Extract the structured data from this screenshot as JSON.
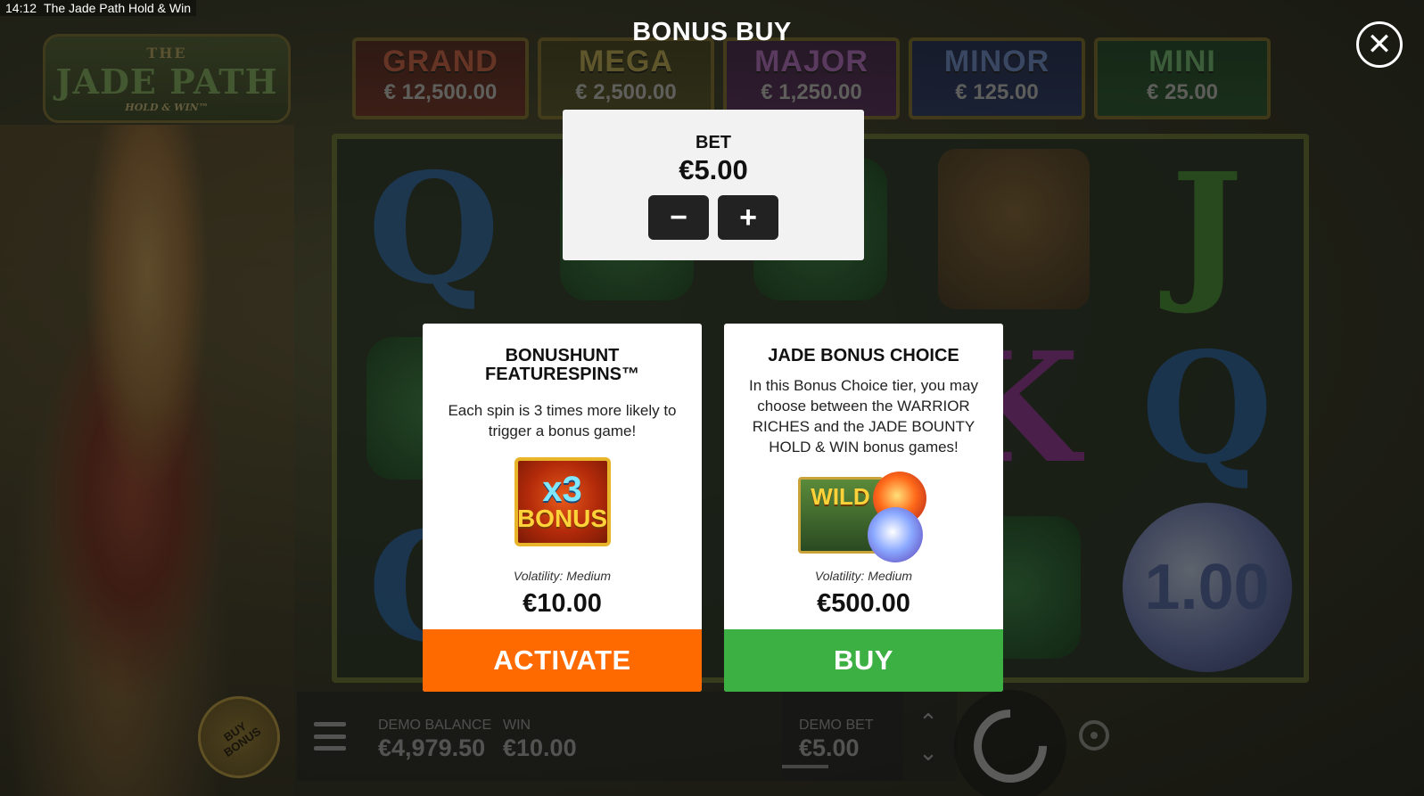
{
  "window": {
    "time": "14:12",
    "title": "The Jade Path Hold & Win"
  },
  "logo": {
    "the": "THE",
    "main": "JADE PATH",
    "sub": "HOLD & WIN™"
  },
  "jackpots": [
    {
      "name": "GRAND",
      "value": "€ 12,500.00"
    },
    {
      "name": "MEGA",
      "value": "€ 2,500.00"
    },
    {
      "name": "MAJOR",
      "value": "€ 1,250.00"
    },
    {
      "name": "MINOR",
      "value": "€ 125.00"
    },
    {
      "name": "MINI",
      "value": "€ 25.00"
    }
  ],
  "reels": {
    "symbols": [
      "Q",
      "mask",
      "mask",
      "warrior",
      "J",
      "mask",
      "mask",
      "mask",
      "K",
      "Q",
      "Q",
      "mask",
      "mask",
      "mask",
      "orb"
    ],
    "orb_value": "1.00"
  },
  "modal": {
    "title": "BONUS BUY",
    "close_icon": "close-icon",
    "bet": {
      "label": "BET",
      "value": "€5.00",
      "minus": "−",
      "plus": "+"
    },
    "cards": [
      {
        "title": "BONUSHUNT FEATURESPINS™",
        "description": "Each spin is 3 times more likely to trigger a bonus game!",
        "art": {
          "multiplier": "x3",
          "word": "BONUS"
        },
        "volatility": "Volatility: Medium",
        "price": "€10.00",
        "cta": "ACTIVATE"
      },
      {
        "title": "JADE BONUS CHOICE",
        "description": "In this Bonus Choice tier, you may choose between the WARRIOR RICHES and the JADE BOUNTY HOLD & WIN bonus games!",
        "art": {
          "word": "WILD"
        },
        "volatility": "Volatility: Medium",
        "price": "€500.00",
        "cta": "BUY"
      }
    ]
  },
  "bottom_bar": {
    "buy_bonus": "BUY BONUS",
    "demo_balance_label": "DEMO BALANCE",
    "demo_balance_value": "€4,979.50",
    "win_label": "WIN",
    "win_value": "€10.00",
    "demo_bet_label": "DEMO BET",
    "demo_bet_value": "€5.00",
    "stepper_up": "⌃",
    "stepper_down": "⌄"
  },
  "colors": {
    "activate": "#ff6a00",
    "buy": "#3cb043"
  }
}
